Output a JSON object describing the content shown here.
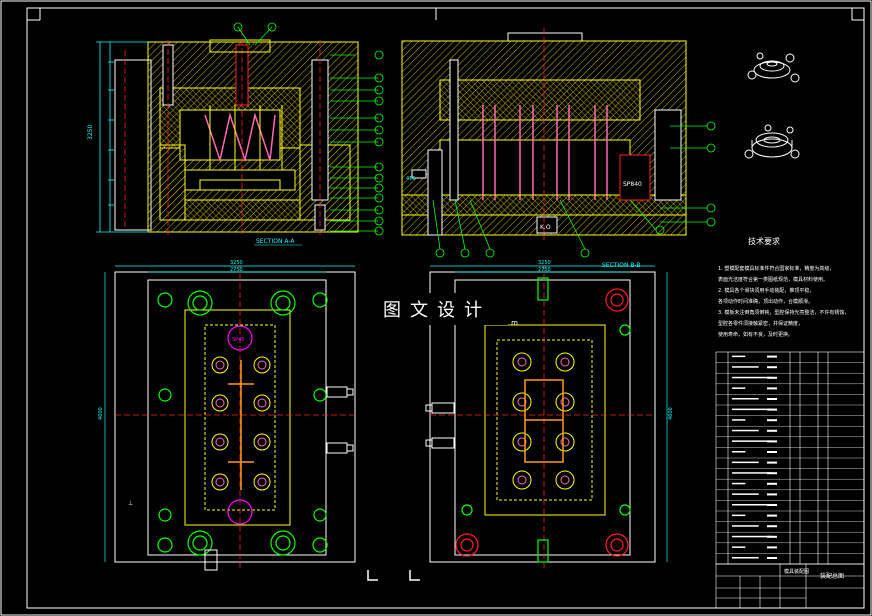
{
  "sections": {
    "left_title": "SECTION A-A",
    "right_title": "SECTION B-B"
  },
  "dims": {
    "left_height": "3250",
    "plate_sp": "SP640",
    "plan_width_outer": "3250",
    "plan_width_inner": "2750",
    "plan_height": "4600",
    "right_width_outer": "3250",
    "right_width_inner": "2750",
    "right_height": "4600",
    "left_dim_a": "416",
    "ko_label": "K.O",
    "sp_label": "SP840"
  },
  "tech": {
    "heading": "技术要求",
    "lines": [
      "1. 塑模配套模具标准件符合国家标准，精度为高级，",
      "表面光洁度符合第一类图纸规范，模具材料使用。",
      "2. 模具各个滑块须用手动装配，推顶平稳，",
      "各项动作时间准确，顶出动作，合模顺滑。",
      "3. 模板未注倒角须倒钝，型腔保持光亮整洁，不许有锈蚀，",
      "型腔各零件须接触紧密，并保证精度，",
      "使用寿命，如有不良，及时更换。"
    ]
  },
  "watermark": {
    "text": "图文设计",
    "sub": "m"
  },
  "title_block": {
    "name": "模具装配图",
    "sub": "装配总图"
  },
  "colors": {
    "yellow": "#ffff00",
    "cyan": "#00ffff",
    "red": "#ff2020",
    "magenta": "#ff00ff",
    "green": "#00ff00",
    "white": "#ffffff",
    "orange": "#ff9a1a"
  }
}
